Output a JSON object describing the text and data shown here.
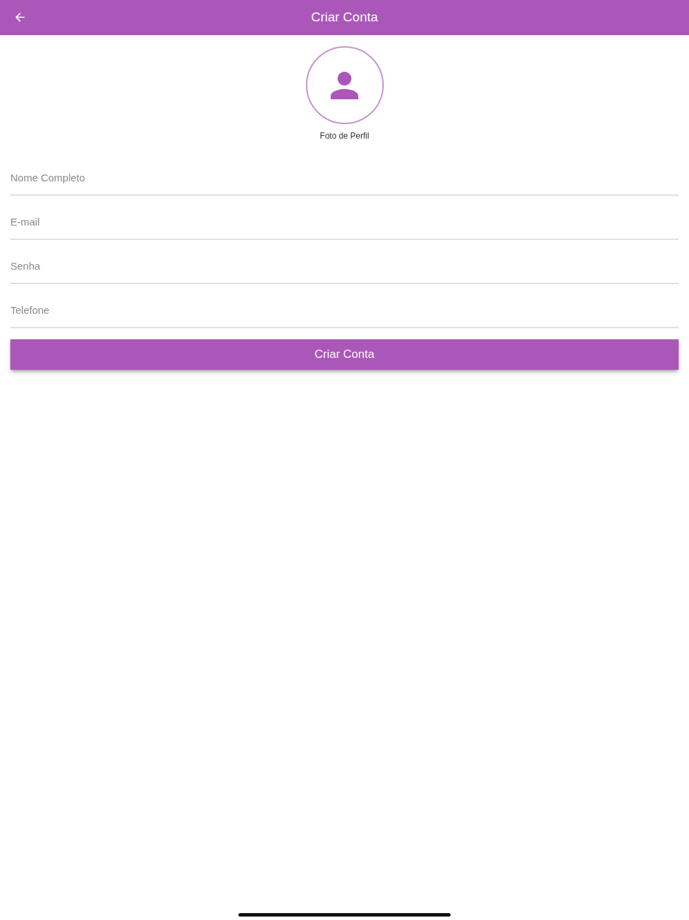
{
  "app_bar": {
    "title": "Criar Conta"
  },
  "profile_photo": {
    "label": "Foto de Perfil"
  },
  "fields": [
    {
      "placeholder": "Nome Completo"
    },
    {
      "placeholder": "E-mail"
    },
    {
      "placeholder": "Senha"
    },
    {
      "placeholder": "Telefone"
    }
  ],
  "submit_button": {
    "label": "Criar Conta"
  }
}
